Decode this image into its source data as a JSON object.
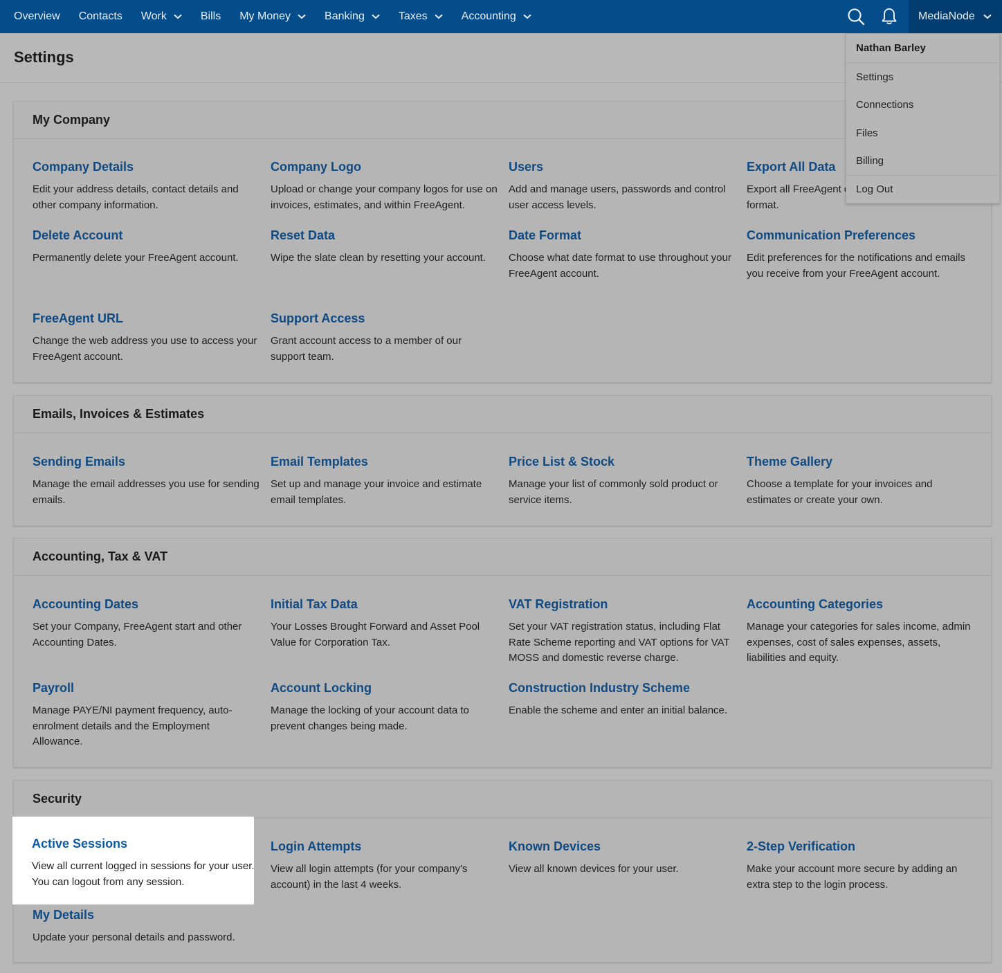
{
  "nav": {
    "items": [
      {
        "label": "Overview",
        "dropdown": false
      },
      {
        "label": "Contacts",
        "dropdown": false
      },
      {
        "label": "Work",
        "dropdown": true
      },
      {
        "label": "Bills",
        "dropdown": false
      },
      {
        "label": "My Money",
        "dropdown": true
      },
      {
        "label": "Banking",
        "dropdown": true
      },
      {
        "label": "Taxes",
        "dropdown": true
      },
      {
        "label": "Accounting",
        "dropdown": true
      }
    ],
    "account_label": "MediaNode"
  },
  "page": {
    "title": "Settings"
  },
  "account_menu": {
    "user_name": "Nathan Barley",
    "items": [
      "Settings",
      "Connections",
      "Files",
      "Billing"
    ],
    "logout": "Log Out"
  },
  "sections": {
    "my_company": {
      "title": "My Company",
      "tiles": [
        {
          "title": "Company Details",
          "desc": "Edit your address details, contact details and other company information."
        },
        {
          "title": "Company Logo",
          "desc": "Upload or change your company logos for use on invoices, estimates, and within FreeAgent."
        },
        {
          "title": "Users",
          "desc": "Add and manage users, passwords and control user access levels."
        },
        {
          "title": "Export All Data",
          "desc": "Export all FreeAgent data in Excel (XLSX) format."
        },
        {
          "title": "Delete Account",
          "desc": "Permanently delete your FreeAgent account."
        },
        {
          "title": "Reset Data",
          "desc": "Wipe the slate clean by resetting your account."
        },
        {
          "title": "Date Format",
          "desc": "Choose what date format to use throughout your FreeAgent account."
        },
        {
          "title": "Communication Preferences",
          "desc": "Edit preferences for the notifications and emails you receive from your FreeAgent account."
        },
        {
          "title": "FreeAgent URL",
          "desc": "Change the web address you use to access your FreeAgent account."
        },
        {
          "title": "Support Access",
          "desc": "Grant account access to a member of our support team."
        }
      ]
    },
    "emails": {
      "title": "Emails, Invoices & Estimates",
      "tiles": [
        {
          "title": "Sending Emails",
          "desc": "Manage the email addresses you use for sending emails."
        },
        {
          "title": "Email Templates",
          "desc": "Set up and manage your invoice and estimate email templates."
        },
        {
          "title": "Price List & Stock",
          "desc": "Manage your list of commonly sold product or service items."
        },
        {
          "title": "Theme Gallery",
          "desc": "Choose a template for your invoices and estimates or create your own."
        }
      ]
    },
    "accounting": {
      "title": "Accounting, Tax & VAT",
      "tiles": [
        {
          "title": "Accounting Dates",
          "desc": "Set your Company, FreeAgent start and other Accounting Dates."
        },
        {
          "title": "Initial Tax Data",
          "desc": "Your Losses Brought Forward and Asset Pool Value for Corporation Tax."
        },
        {
          "title": "VAT Registration",
          "desc": "Set your VAT registration status, including Flat Rate Scheme reporting and VAT options for VAT MOSS and domestic reverse charge."
        },
        {
          "title": "Accounting Categories",
          "desc": "Manage your categories for sales income, admin expenses, cost of sales expenses, assets, liabilities and equity."
        },
        {
          "title": "Payroll",
          "desc": "Manage PAYE/NI payment frequency, auto-enrolment details and the Employment Allowance."
        },
        {
          "title": "Account Locking",
          "desc": "Manage the locking of your account data to prevent changes being made."
        },
        {
          "title": "Construction Industry Scheme",
          "desc": "Enable the scheme and enter an initial balance."
        }
      ]
    },
    "security": {
      "title": "Security",
      "tiles": [
        {
          "title": "Active Sessions",
          "desc": "View all current logged in sessions for your user. You can logout from any session."
        },
        {
          "title": "Login Attempts",
          "desc": "View all login attempts (for your company's account) in the last 4 weeks."
        },
        {
          "title": "Known Devices",
          "desc": "View all known devices for your user."
        },
        {
          "title": "2-Step Verification",
          "desc": "Make your account more secure by adding an extra step to the login process."
        },
        {
          "title": "My Details",
          "desc": "Update your personal details and password."
        }
      ]
    }
  },
  "icons": {
    "search": "search-icon",
    "notifications": "bell-icon",
    "chevron": "chevron-down-icon"
  },
  "colors": {
    "nav_bg": "#044c8a",
    "link": "#0f4a83",
    "highlight_link": "#0b5aa3"
  }
}
